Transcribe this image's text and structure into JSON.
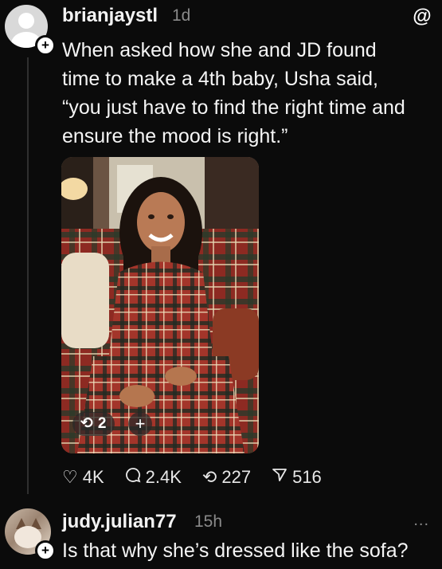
{
  "post": {
    "username": "brianjaystl",
    "time": "1d",
    "text": "When asked how she and JD found time to make a 4th baby, Usha said, “you just have to find the right time and ensure the mood is right.”",
    "follow_badge": "+",
    "app_logo_icon": "threads-logo-icon",
    "media": {
      "repost_count": "2",
      "add_label": "+"
    },
    "stats": {
      "likes": "4K",
      "replies": "2.4K",
      "reposts": "227",
      "shares": "516"
    }
  },
  "reply": {
    "username": "judy.julian77",
    "time": "15h",
    "more": "...",
    "text": "Is that why she’s dressed like the sofa?",
    "follow_badge": "+"
  },
  "colors": {
    "background": "#0b0b0b",
    "text": "#f3f3f3",
    "muted": "#8a8a8a"
  }
}
